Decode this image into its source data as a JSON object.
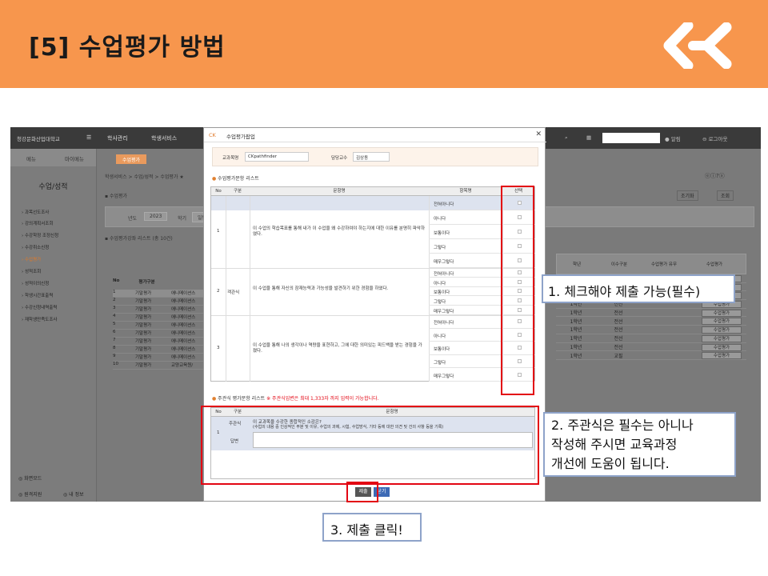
{
  "slide": {
    "title": "[5]  수업평가  방법",
    "colors": {
      "banner": "#f7964d",
      "highlight": "#e30613",
      "callout_border": "#8ea3c9"
    }
  },
  "app": {
    "brand": "청강문화산업대학교",
    "nav": [
      "학사관리",
      "학생서비스"
    ],
    "user_util": [
      "알림",
      "로그아웃"
    ],
    "side_tabs": [
      "메뉴",
      "마이메뉴"
    ],
    "side_title": "수업/성적",
    "side_items": [
      "과목선도조사",
      "강의계획서조회",
      "수강학정 조정신청",
      "수강취소신청",
      "수업평가",
      "성적조회",
      "성적이의신청",
      "학생시간표출력",
      "수강신청내역출력",
      "재학생만족도조사"
    ],
    "side_footer": [
      "화면모드",
      "원격지원",
      "내 정보"
    ],
    "main_tab": "수업평가",
    "breadcrumb": "학생서비스 > 수업/성적 > 수업평가 ★",
    "page_heading": "수업평가",
    "filter_labels": [
      "년도",
      "학기"
    ],
    "filter_year": "2023",
    "filter_term": "일반학기",
    "list_title": "수업평가강좌 리스트 (총 10건)",
    "table_header": [
      "No",
      "평가구분"
    ],
    "table_rows": [
      {
        "no": "1",
        "kind": "기말평가",
        "course": "애니메이션스"
      },
      {
        "no": "2",
        "kind": "기말평가",
        "course": "애니메이션스"
      },
      {
        "no": "3",
        "kind": "기말평가",
        "course": "애니메이션스"
      },
      {
        "no": "4",
        "kind": "기말평가",
        "course": "애니메이션스"
      },
      {
        "no": "5",
        "kind": "기말평가",
        "course": "애니메이션스"
      },
      {
        "no": "6",
        "kind": "기말평가",
        "course": "애니메이션스"
      },
      {
        "no": "7",
        "kind": "기말평가",
        "course": "애니메이션스"
      },
      {
        "no": "8",
        "kind": "기말평가",
        "course": "애니메이션스"
      },
      {
        "no": "9",
        "kind": "기말평가",
        "course": "애니메이션스"
      },
      {
        "no": "10",
        "kind": "기말평가",
        "course": "교양교육원/"
      }
    ],
    "right_header": [
      "학년",
      "이수구분",
      "수업평가 유무",
      "수업평가"
    ],
    "right_rows": [
      {
        "grade": "1학년",
        "type": "전선"
      },
      {
        "grade": "1학년",
        "type": "전선"
      },
      {
        "grade": "1학년",
        "type": "전선"
      },
      {
        "grade": "1학년",
        "type": "전선"
      },
      {
        "grade": "1학년",
        "type": "전선"
      },
      {
        "grade": "1학년",
        "type": "전선"
      },
      {
        "grade": "1학년",
        "type": "전선"
      },
      {
        "grade": "1학년",
        "type": "전선"
      },
      {
        "grade": "1학년",
        "type": "전선"
      },
      {
        "grade": "1학년",
        "type": "교필"
      }
    ],
    "eval_button": "수업평가",
    "toolbar_buttons": [
      "조기화",
      "조회"
    ]
  },
  "modal": {
    "title": "수업평가팝업",
    "course_label": "교과목명",
    "course_value": "CKpathfinder",
    "prof_label": "담당교수",
    "prof_value": "김상동",
    "list_title": "수업평가문항 리스트",
    "headers": [
      "No",
      "구분",
      "문항명",
      "항목명",
      "선택"
    ],
    "category": "객관식",
    "questions": [
      {
        "no": "1",
        "text": "이 수업의 학습목표를 통해 내가 이 수업을 왜 수강하여야 하는지에 대한 이유를 분명히 파악하였다."
      },
      {
        "no": "2",
        "text": "이 수업을 통해 자신의 잠재능력과 가능성을 발견하기 위한 경험을 하였다."
      },
      {
        "no": "3",
        "text": "이 수업을 통해 나의 생각이나 역량을 표현하고, 그에 대한 의미있는 피드백을 받는 경험을 가졌다."
      }
    ],
    "options": [
      "전혀아니다",
      "아니다",
      "보통이다",
      "그렇다",
      "매우그렇다"
    ],
    "subj_title": "주관식 평가문항 리스트",
    "subj_note": "※ 주관식입변은 최대 1,333자 까지 입력이 가능합니다.",
    "subj_headers": [
      "No",
      "구분",
      "문항명"
    ],
    "subj_no": "1",
    "subj_category": "주관식",
    "subj_answer_label": "답변",
    "subj_question": "이 교과목을 수강한 종합적인 소감은?",
    "subj_question_detail": "(수업의 내용 중 인상적인 부분 및 이유, 수업의 과제, 시험, 수업방식, 기타 등에 대한 의견 및 건의 사항 등을 기록)",
    "submit_label": "제출",
    "close_label": "닫기"
  },
  "callouts": {
    "c1": "1. 체크해야 제출 가능(필수)",
    "c2_line1": "2. 주관식은 필수는 아니나",
    "c2_line2": "작성해 주시면 교육과정",
    "c2_line3": "개선에 도움이 됩니다.",
    "c3": "3. 제출 클릭!"
  }
}
